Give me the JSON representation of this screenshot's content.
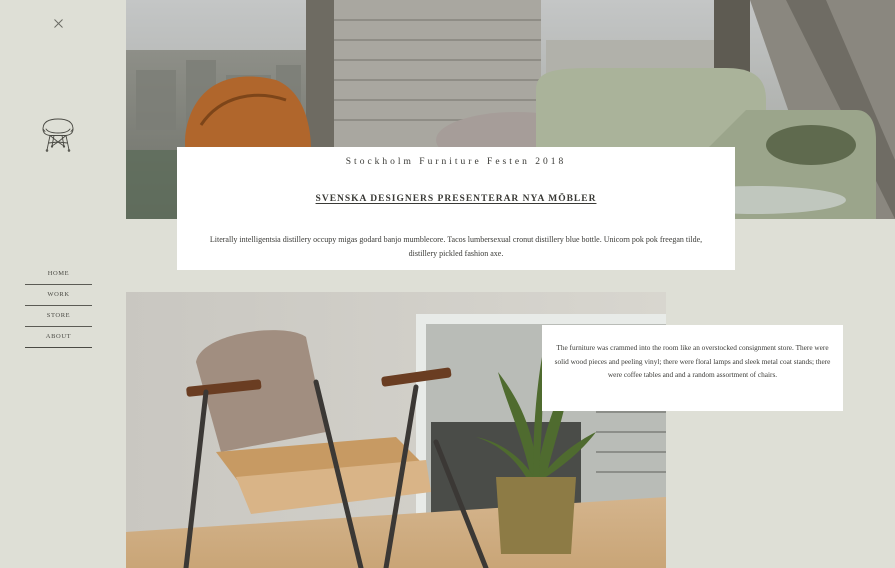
{
  "sidebar": {
    "close_icon": "close-icon",
    "logo_icon": "eames-chair-icon",
    "nav": [
      {
        "label": "HOME"
      },
      {
        "label": "WORK"
      },
      {
        "label": "STORE"
      },
      {
        "label": "ABOUT"
      }
    ]
  },
  "hero": {
    "image": "living-room-window-chairs-photo",
    "eyebrow": "Stockholm Furniture Festen 2018",
    "headline": "SVENSKA DESIGNERS PRESENTERAR NYA MÖBLER",
    "body": "Literally intelligentsia distillery occupy migas godard banjo mumblecore. Tacos lumbersexual cronut distillery blue bottle. Unicorn pok pok freegan tilde, distillery pickled fashion axe."
  },
  "feature": {
    "image": "armchair-and-plant-photo",
    "body": "The furniture was crammed into the room like an overstocked consignment store. There were solid wood pieces and peeling vinyl; there were floral lamps and sleek metal coat stands; there were coffee tables and and a random assortment of chairs."
  },
  "colors": {
    "background": "#dedfd6",
    "card": "#ffffff",
    "text": "#3a3a36"
  }
}
